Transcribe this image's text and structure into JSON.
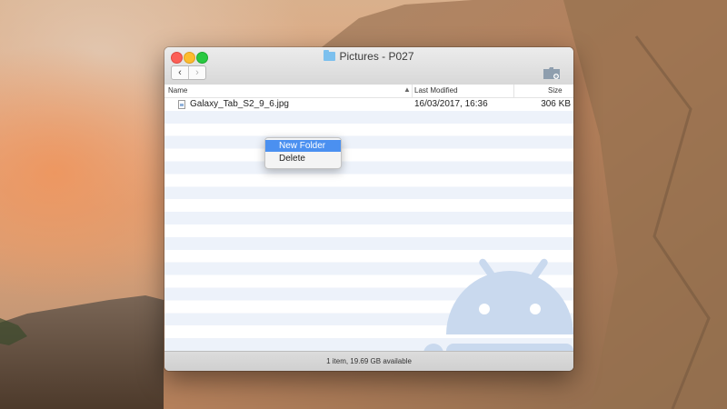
{
  "window": {
    "title": "Pictures - P027",
    "title_icon": "folder-icon",
    "nav": {
      "back_icon": "chevron-left-icon",
      "forward_icon": "chevron-right-icon",
      "back_glyph": "‹",
      "forward_glyph": "›"
    },
    "toolbar": {
      "new_folder_icon": "new-folder-icon"
    }
  },
  "columns": {
    "name": "Name",
    "sort_glyph": "▲",
    "modified": "Last Modified",
    "size": "Size"
  },
  "files": [
    {
      "name": "Galaxy_Tab_S2_9_6.jpg",
      "modified": "16/03/2017, 16:36",
      "size": "306 KB"
    }
  ],
  "status": {
    "text": "1 item, 19.69 GB available"
  },
  "context_menu": {
    "items": [
      "New Folder",
      "Delete"
    ],
    "highlighted_index": 0
  },
  "colors": {
    "highlight": "#4b90f0",
    "stripe": "#edf2fa",
    "watermark": "#c9d9ee"
  }
}
